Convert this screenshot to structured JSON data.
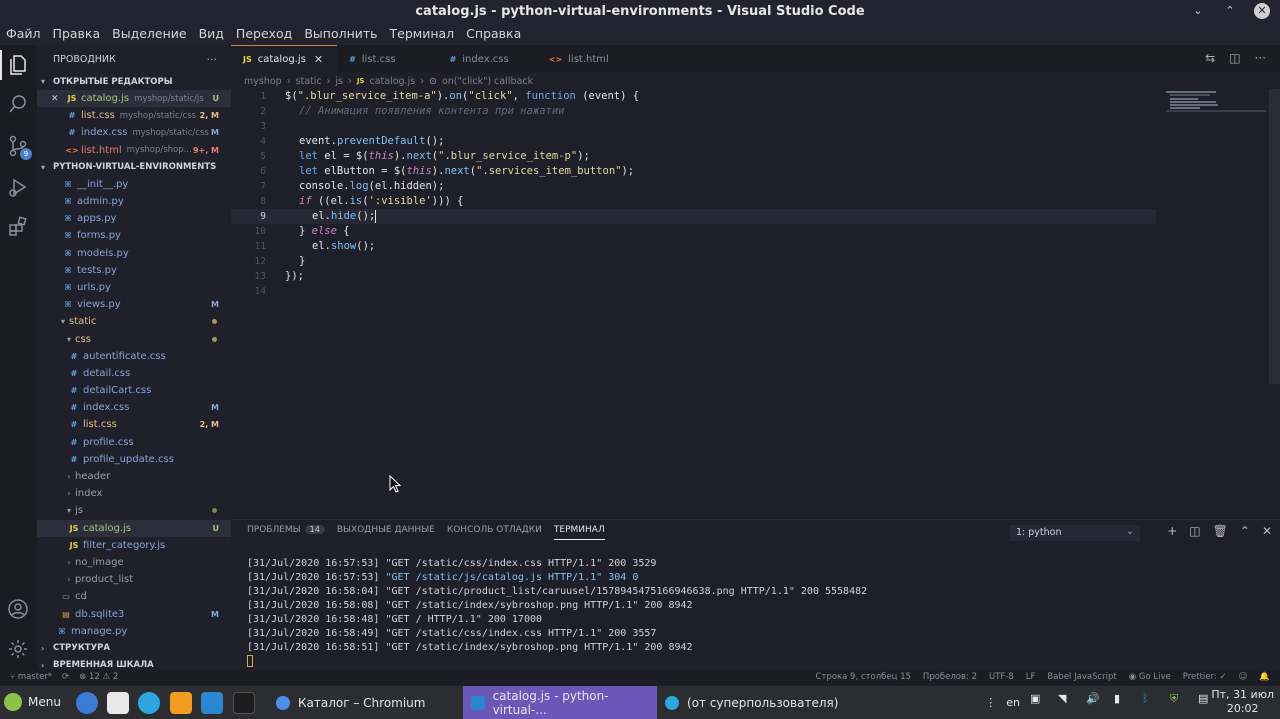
{
  "window": {
    "title": "catalog.js - python-virtual-environments - Visual Studio Code"
  },
  "menu": [
    "Файл",
    "Правка",
    "Выделение",
    "Вид",
    "Переход",
    "Выполнить",
    "Терминал",
    "Справка"
  ],
  "sidebar": {
    "header": "ПРОВОДНИК",
    "open_editors_title": "ОТКРЫТЫЕ РЕДАКТОРЫ",
    "open_editors": [
      {
        "close": "✕",
        "icon": "JS",
        "name": "catalog.js",
        "path": "myshop/static/js",
        "badge": "U"
      },
      {
        "icon": "#",
        "name": "list.css",
        "path": "myshop/static/css",
        "badge": "2, M"
      },
      {
        "icon": "#",
        "name": "index.css",
        "path": "myshop/static/css",
        "badge": "M"
      },
      {
        "icon": "<>",
        "name": "list.html",
        "path": "myshop/shop...",
        "badge": "9+, M"
      }
    ],
    "project_title": "PYTHON-VIRTUAL-ENVIRONMENTS",
    "tree": [
      {
        "icon": "py",
        "name": "__init__.py"
      },
      {
        "icon": "py",
        "name": "admin.py"
      },
      {
        "icon": "py",
        "name": "apps.py"
      },
      {
        "icon": "py",
        "name": "forms.py"
      },
      {
        "icon": "py",
        "name": "models.py"
      },
      {
        "icon": "py",
        "name": "tests.py"
      },
      {
        "icon": "py",
        "name": "urls.py"
      },
      {
        "icon": "py",
        "name": "views.py",
        "badge": "M"
      },
      {
        "folder": "static"
      },
      {
        "folder": "css"
      },
      {
        "icon": "#",
        "name": "autentificate.css"
      },
      {
        "icon": "#",
        "name": "detail.css"
      },
      {
        "icon": "#",
        "name": "detailCart.css"
      },
      {
        "icon": "#",
        "name": "index.css",
        "badge": "M"
      },
      {
        "icon": "#",
        "name": "list.css",
        "badge": "2, M"
      },
      {
        "icon": "#",
        "name": "profile.css"
      },
      {
        "icon": "#",
        "name": "profile_update.css"
      },
      {
        "folder": "header"
      },
      {
        "folder": "index"
      },
      {
        "folder": "js"
      },
      {
        "icon": "JS",
        "name": "catalog.js",
        "badge": "U"
      },
      {
        "icon": "JS",
        "name": "filter_category.js"
      },
      {
        "folder": "no_image"
      },
      {
        "folder": "product_list"
      },
      {
        "folder": "cd"
      },
      {
        "icon": "db",
        "name": "db.sqlite3",
        "badge": "M"
      },
      {
        "icon": "py",
        "name": "manage.py"
      }
    ],
    "structure_title": "СТРУКТУРА",
    "timeline_title": "ВРЕМЕННАЯ ШКАЛА"
  },
  "tabs": [
    {
      "icon": "JS",
      "label": "catalog.js",
      "close": "✕"
    },
    {
      "icon": "#",
      "label": "list.css"
    },
    {
      "icon": "#",
      "label": "index.css"
    },
    {
      "icon": "<>",
      "label": "list.html"
    }
  ],
  "breadcrumb": [
    "myshop",
    "static",
    "js",
    "catalog.js",
    "on(\"click\") callback"
  ],
  "code_lines": [
    "1",
    "2",
    "3",
    "4",
    "5",
    "6",
    "7",
    "8",
    "9",
    "10",
    "11",
    "12",
    "13",
    "14"
  ],
  "code": {
    "l1": {
      "a": "$(",
      "b": "\".blur_service_item-a\"",
      "c": ").",
      "d": "on",
      "e": "(",
      "f": "\"click\"",
      "g": ", ",
      "h": "function",
      "i": " (event) {"
    },
    "l2": "// Анимация появления контента при нажатии",
    "l4": {
      "a": "event.",
      "b": "preventDefault",
      "c": "();"
    },
    "l5": {
      "a": "let",
      "b": " el = $(",
      "c": "this",
      "d": ").",
      "e": "next",
      "f": "(",
      "g": "\".blur_service_item-p\"",
      "h": ");"
    },
    "l6": {
      "a": "let",
      "b": " elButton = $(",
      "c": "this",
      "d": ").",
      "e": "next",
      "f": "(",
      "g": "\".services_item_button\"",
      "h": ");"
    },
    "l7": {
      "a": "console.",
      "b": "log",
      "c": "(el.hidden);"
    },
    "l8": {
      "a": "if",
      "b": " ((el.",
      "c": "is",
      "d": "(",
      "e": "':visible'",
      "f": "))) {"
    },
    "l9": {
      "a": "el.",
      "b": "hide",
      "c": "();"
    },
    "l10": {
      "a": "} ",
      "b": "else",
      "c": " {"
    },
    "l11": {
      "a": "el.",
      "b": "show",
      "c": "();"
    },
    "l12": "}",
    "l13": "});"
  },
  "panel": {
    "tabs": [
      {
        "label": "ПРОБЛЕМЫ",
        "count": "14"
      },
      {
        "label": "ВЫХОДНЫЕ ДАННЫЕ"
      },
      {
        "label": "КОНСОЛЬ ОТЛАДКИ"
      },
      {
        "label": "ТЕРМИНАЛ"
      }
    ],
    "terminal_select": "1: python",
    "terminal_lines": [
      {
        "pre": "[31/Jul/2020 16:57:53] ",
        "main": "\"GET /static/css/index.css HTTP/1.1\" 200 3529",
        "hl": false
      },
      {
        "pre": "[31/Jul/2020 16:57:53] ",
        "main": "\"GET /static/js/catalog.js HTTP/1.1\" 304 0",
        "hl": true
      },
      {
        "pre": "[31/Jul/2020 16:58:04] ",
        "main": "\"GET /static/product_list/caruusel/1578945475166946638.png HTTP/1.1\" 200 5558482",
        "hl": false
      },
      {
        "pre": "[31/Jul/2020 16:58:08] ",
        "main": "\"GET /static/index/sybroshop.png HTTP/1.1\" 200 8942",
        "hl": false
      },
      {
        "pre": "[31/Jul/2020 16:58:48] ",
        "main": "\"GET / HTTP/1.1\" 200 17000",
        "hl": false
      },
      {
        "pre": "[31/Jul/2020 16:58:49] ",
        "main": "\"GET /static/css/index.css HTTP/1.1\" 200 3557",
        "hl": false
      },
      {
        "pre": "[31/Jul/2020 16:58:51] ",
        "main": "\"GET /static/index/sybroshop.png HTTP/1.1\" 200 8942",
        "hl": false
      }
    ]
  },
  "status": {
    "branch": "master*",
    "problems": "⊗ 12 ⚠ 2",
    "position": "Строка 9, столбец 15",
    "spaces": "Пробелов: 2",
    "encoding": "UTF-8",
    "eol": "LF",
    "language": "Babel JavaScript",
    "golive": "Go Live",
    "prettier": "Prettier: ✓"
  },
  "taskbar": {
    "menu_label": "Menu",
    "tasks": [
      {
        "label": "Каталог – Chromium"
      },
      {
        "label": "catalog.js - python-virtual-..."
      },
      {
        "label": "(от суперпользователя)"
      }
    ],
    "lang": "en",
    "clock_day": "Пт, 31 июл",
    "clock_time": "20:02"
  }
}
